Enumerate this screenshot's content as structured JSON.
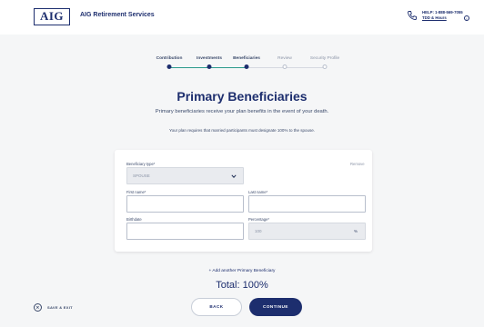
{
  "header": {
    "logo_text": "AIG",
    "brand": "AIG Retirement Services",
    "help_phone": "HELP: 1-888-569-7055",
    "help_tdd": "TDD & Hours"
  },
  "stepper": {
    "steps": [
      {
        "label": "Contribution",
        "state": "done"
      },
      {
        "label": "Investments",
        "state": "done"
      },
      {
        "label": "Beneficiaries",
        "state": "current"
      },
      {
        "label": "Review",
        "state": "todo"
      },
      {
        "label": "Security Profile",
        "state": "todo"
      }
    ]
  },
  "page": {
    "title": "Primary Beneficiaries",
    "subtitle": "Primary beneficiaries receive your plan benefits in the event of your death.",
    "note": "Your plan requires that married participants must designate 100% to the spouse."
  },
  "form": {
    "beneficiary_type_label": "Beneficiary type*",
    "beneficiary_type_value": "SPOUSE",
    "remove_label": "Remove",
    "first_name_label": "First name*",
    "first_name_value": "",
    "last_name_label": "Last name*",
    "last_name_value": "",
    "birthdate_label": "Birthdate",
    "birthdate_value": "",
    "percentage_label": "Percentage*",
    "percentage_value": "100",
    "percent_sign": "%"
  },
  "add_beneficiary_label": "+ Add another Primary Beneficiary",
  "total_text": "Total: 100%",
  "footer": {
    "save_exit_label": "SAVE & EXIT",
    "back_label": "BACK",
    "continue_label": "CONTINUE"
  },
  "colors": {
    "brand": "#1d2e6e",
    "progress_active": "#2b9a8c",
    "background": "#f5f6f7"
  }
}
